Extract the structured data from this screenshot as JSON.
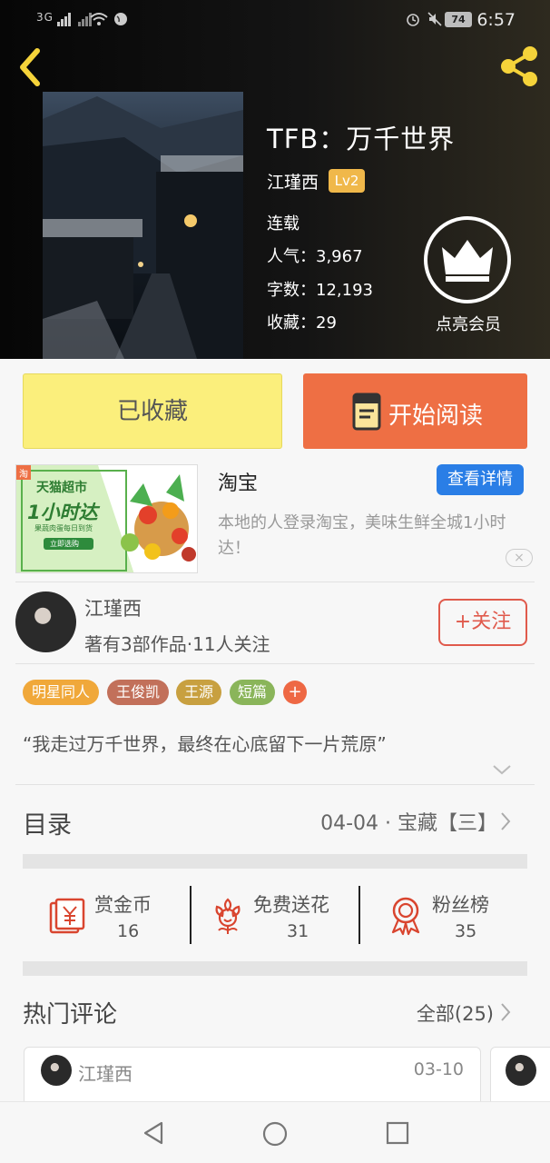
{
  "status_bar": {
    "network": "3G",
    "battery": "74",
    "time": "6:57"
  },
  "book": {
    "title": "TFB：万千世界",
    "author": "江瑾西",
    "level": "Lv2",
    "status": "连载",
    "popularity": "人气：3,967",
    "word_count": "字数：12,193",
    "favorites": "收藏：29"
  },
  "vip": {
    "label": "点亮会员"
  },
  "actions": {
    "collected_label": "已收藏",
    "read_label": "开始阅读"
  },
  "ad": {
    "title": "淘宝",
    "detail_button": "查看详情",
    "description": "本地的人登录淘宝，美味生鲜全城1小时达！",
    "image_badge": "淘",
    "image_title": "天猫超市",
    "image_big": "1小时达",
    "image_sub": "果蔬肉蛋每日到货",
    "image_cta": "立即选购",
    "close_icon": "×"
  },
  "author": {
    "name": "江瑾西",
    "meta": "著有3部作品·11人关注",
    "follow_label": "+关注"
  },
  "tags": [
    {
      "label": "明星同人",
      "color": "#f0a83a"
    },
    {
      "label": "王俊凯",
      "color": "#c2705a"
    },
    {
      "label": "王源",
      "color": "#c8a040"
    },
    {
      "label": "短篇",
      "color": "#8ab55a"
    }
  ],
  "tag_plus": "+",
  "intro": "“我走过万千世界，最终在心底留下一片荒原”",
  "catalog": {
    "title": "目录",
    "latest": "04-04 · 宝藏【三】"
  },
  "stats": [
    {
      "label": "赏金币",
      "value": "16",
      "icon": "red-envelope-icon"
    },
    {
      "label": "免费送花",
      "value": "31",
      "icon": "flower-icon"
    },
    {
      "label": "粉丝榜",
      "value": "35",
      "icon": "medal-icon"
    }
  ],
  "comments": {
    "title": "热门评论",
    "all_label": "全部(25)",
    "items": [
      {
        "name": "江瑾西",
        "date": "03-10"
      }
    ]
  },
  "colors": {
    "accent_orange": "#ee6f44",
    "collect_yellow": "#fbef7c",
    "follow_red": "#e05a4c",
    "badge_gold": "#f0b84a",
    "ad_blue": "#2a7ee6"
  }
}
